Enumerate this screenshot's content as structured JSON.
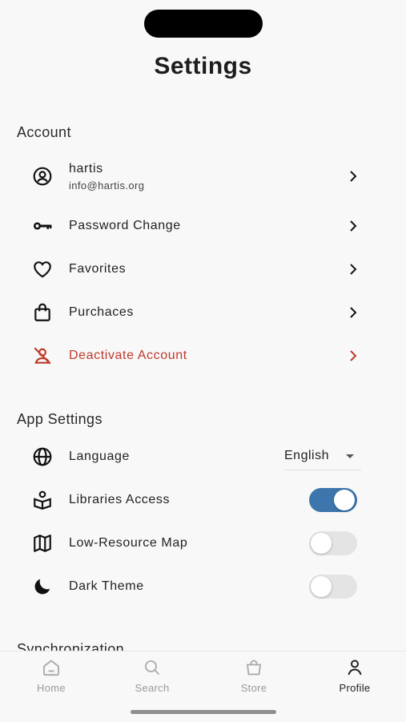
{
  "header": {
    "title": "Settings"
  },
  "account": {
    "section_title": "Account",
    "user": {
      "name": "hartis",
      "email": "info@hartis.org"
    },
    "items": [
      {
        "label": "Password Change"
      },
      {
        "label": "Favorites"
      },
      {
        "label": "Purchaces"
      },
      {
        "label": "Deactivate Account",
        "color": "#c0392b"
      }
    ]
  },
  "app_settings": {
    "section_title": "App Settings",
    "language": {
      "label": "Language",
      "value": "English"
    },
    "libraries_access": {
      "label": "Libraries Access",
      "enabled": true
    },
    "low_resource_map": {
      "label": "Low-Resource Map",
      "enabled": false
    },
    "dark_theme": {
      "label": "Dark Theme",
      "enabled": false
    }
  },
  "synchronization": {
    "section_title": "Synchronization"
  },
  "tabbar": {
    "items": [
      {
        "label": "Home",
        "icon": "home-icon"
      },
      {
        "label": "Search",
        "icon": "search-icon"
      },
      {
        "label": "Store",
        "icon": "store-bag-icon"
      },
      {
        "label": "Profile",
        "icon": "profile-icon",
        "active": true
      }
    ]
  },
  "colors": {
    "accent": "#3d76ad",
    "danger": "#c0392b"
  }
}
